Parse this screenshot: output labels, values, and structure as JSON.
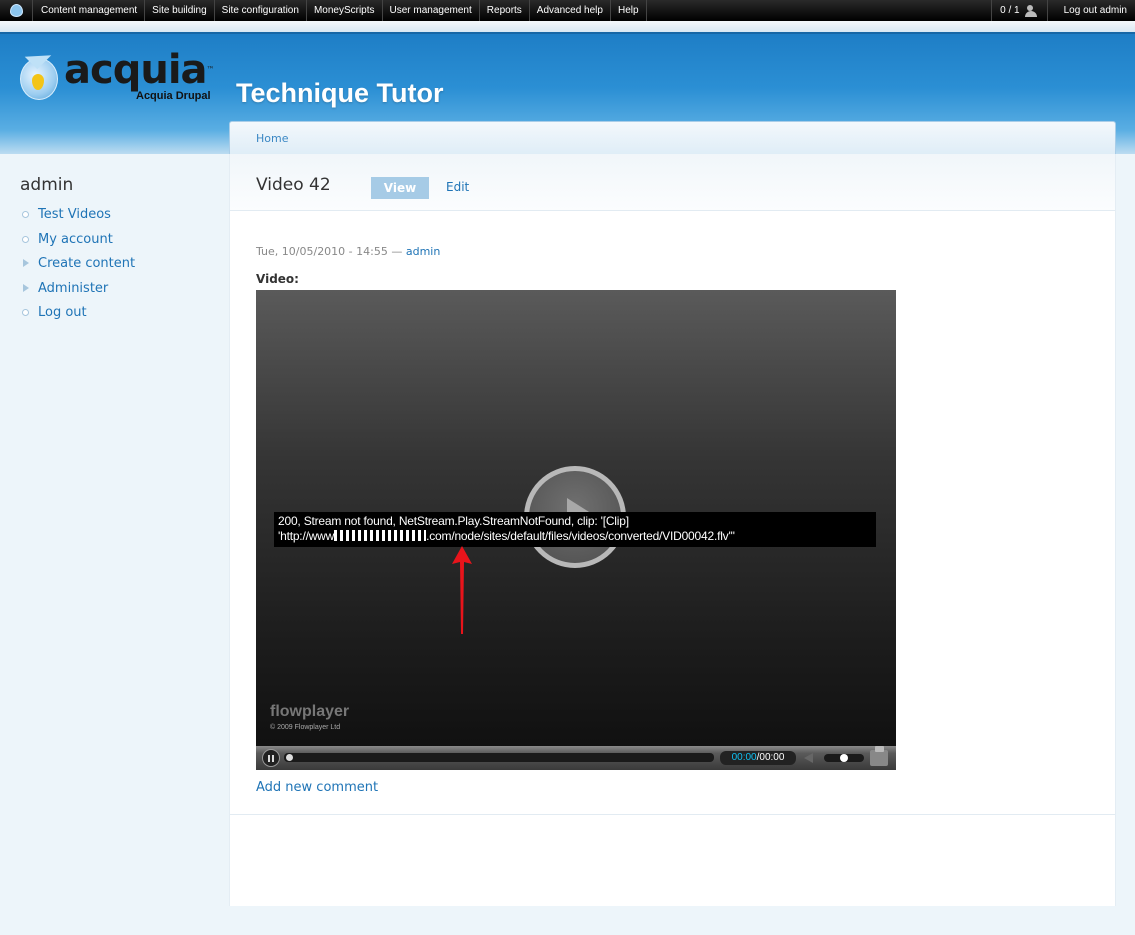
{
  "toolbar": {
    "menu": [
      "Content management",
      "Site building",
      "Site configuration",
      "MoneyScripts",
      "User management",
      "Reports",
      "Advanced help",
      "Help"
    ],
    "users_count": "0 / 1",
    "logout": "Log out admin"
  },
  "header": {
    "logo_word": "acquia",
    "logo_tm": "™",
    "logo_sub": "Acquia Drupal",
    "site_name": "Technique Tutor"
  },
  "breadcrumb": {
    "home": "Home"
  },
  "sidebar": {
    "title": "admin",
    "items": [
      {
        "label": "Test Videos",
        "marker": "circle"
      },
      {
        "label": "My account",
        "marker": "circle"
      },
      {
        "label": "Create content",
        "marker": "triangle"
      },
      {
        "label": "Administer",
        "marker": "triangle"
      },
      {
        "label": "Log out",
        "marker": "circle"
      }
    ]
  },
  "node": {
    "title": "Video 42",
    "tab_view": "View",
    "tab_edit": "Edit",
    "submitted_date": "Tue, 10/05/2010 - 14:55",
    "submitted_sep": " — ",
    "author": "admin",
    "field_label": "Video:",
    "add_comment": "Add new comment"
  },
  "player": {
    "error_line1": "200, Stream not found, NetStream.Play.StreamNotFound, clip: '[Clip]",
    "error_line2_start": "'http://www",
    "error_line2_end": ".com/node/sites/default/files/videos/converted/VID00042.flv'\"",
    "brand": "flowplayer",
    "copyright": "© 2009 Flowplayer Ltd",
    "time_current": "00:00",
    "time_sep": "/",
    "time_total": "00:00",
    "accent_color": "#0fc0f2",
    "arrow_color": "#e8141b"
  }
}
